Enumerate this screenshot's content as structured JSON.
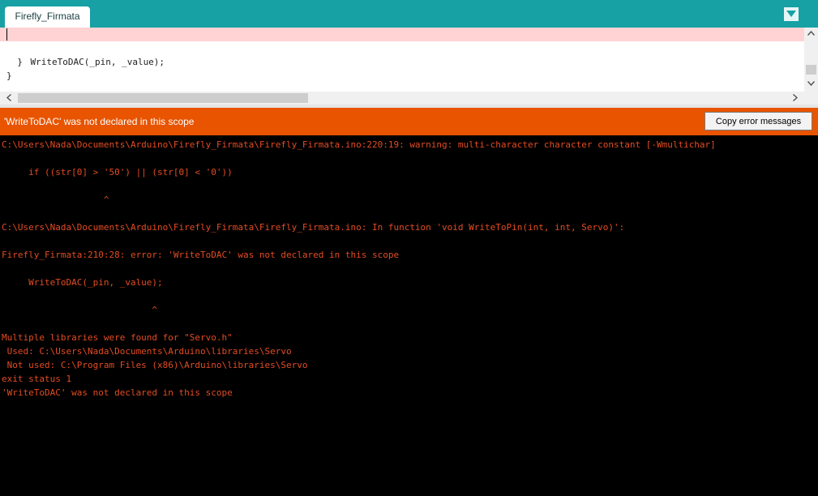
{
  "tabs": [
    {
      "label": "Firefly_Firmata",
      "active": true
    }
  ],
  "editor": {
    "lines": [
      "    WriteToDAC(_pin, _value);",
      "  }",
      "}",
      "/*"
    ]
  },
  "error_bar": {
    "message": "'WriteToDAC' was not declared in this scope",
    "copy_button_label": "Copy error messages"
  },
  "console": {
    "lines": [
      "C:\\Users\\Nada\\Documents\\Arduino\\Firefly_Firmata\\Firefly_Firmata.ino:220:19: warning: multi-character character constant [-Wmultichar]",
      "     if ((str[0] > '50') || (str[0] < '0'))",
      "                   ^",
      "C:\\Users\\Nada\\Documents\\Arduino\\Firefly_Firmata\\Firefly_Firmata.ino: In function 'void WriteToPin(int, int, Servo)':",
      "Firefly_Firmata:210:28: error: 'WriteToDAC' was not declared in this scope",
      "     WriteToDAC(_pin, _value);",
      "                            ^",
      "Multiple libraries were found for \"Servo.h\"",
      " Used: C:\\Users\\Nada\\Documents\\Arduino\\libraries\\Servo",
      " Not used: C:\\Program Files (x86)\\Arduino\\libraries\\Servo",
      "exit status 1",
      "'WriteToDAC' was not declared in this scope"
    ]
  },
  "colors": {
    "tabbar": "#17a1a5",
    "error_bar": "#e85400",
    "console_text": "#e34c22",
    "line_highlight": "#ffd3d3"
  }
}
